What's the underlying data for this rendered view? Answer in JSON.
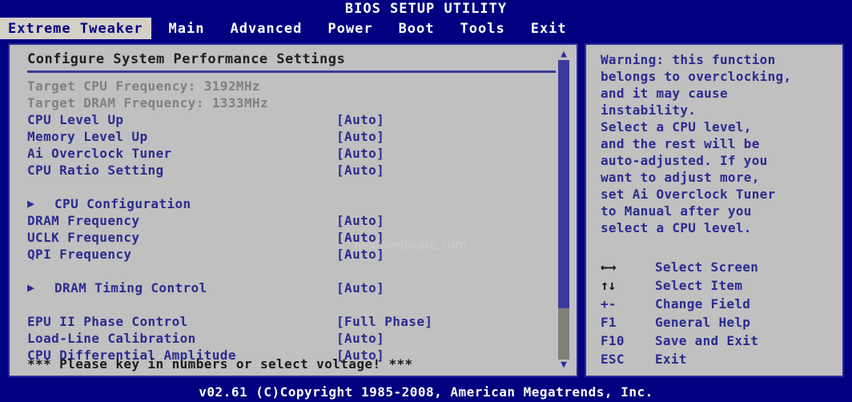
{
  "window": {
    "title": "BIOS SETUP UTILITY",
    "footer": "v02.61 (C)Copyright 1985-2008, American Megatrends, Inc."
  },
  "menubar": {
    "tabs": [
      {
        "label": "Extreme Tweaker",
        "active": true
      },
      {
        "label": "Main",
        "active": false
      },
      {
        "label": "Advanced",
        "active": false
      },
      {
        "label": "Power",
        "active": false
      },
      {
        "label": "Boot",
        "active": false
      },
      {
        "label": "Tools",
        "active": false
      },
      {
        "label": "Exit",
        "active": false
      }
    ]
  },
  "main": {
    "panel_title": "Configure System Performance Settings",
    "watermark": "nexthardware.com",
    "note": "*** Please key in numbers or select voltage! ***",
    "rows": [
      {
        "label": "Target CPU Frequency: 3192MHz",
        "value": "",
        "style": "dim"
      },
      {
        "label": "Target DRAM Frequency: 1333MHz",
        "value": "",
        "style": "dim"
      },
      {
        "label": "CPU Level Up",
        "value": "[Auto]",
        "style": "normal"
      },
      {
        "label": "Memory Level Up",
        "value": "[Auto]",
        "style": "normal"
      },
      {
        "label": "Ai Overclock Tuner",
        "value": "[Auto]",
        "style": "normal"
      },
      {
        "label": "CPU Ratio Setting",
        "value": "[Auto]",
        "style": "normal"
      },
      {
        "label": "",
        "value": "",
        "style": "gap"
      },
      {
        "label": "CPU Configuration",
        "value": "",
        "style": "submenu"
      },
      {
        "label": "DRAM Frequency",
        "value": "[Auto]",
        "style": "normal"
      },
      {
        "label": "UCLK Frequency",
        "value": "[Auto]",
        "style": "normal"
      },
      {
        "label": "QPI Frequency",
        "value": "[Auto]",
        "style": "normal"
      },
      {
        "label": "",
        "value": "",
        "style": "gap"
      },
      {
        "label": "DRAM Timing Control",
        "value": "[Auto]",
        "style": "submenu"
      },
      {
        "label": "",
        "value": "",
        "style": "gap"
      },
      {
        "label": "EPU II Phase Control",
        "value": "[Full Phase]",
        "style": "normal"
      },
      {
        "label": "Load-Line Calibration",
        "value": "[Auto]",
        "style": "normal"
      },
      {
        "label": "CPU Differential Amplitude",
        "value": "[Auto]",
        "style": "normal"
      }
    ],
    "scrollbar": {
      "up_arrow": "▲",
      "down_arrow": "▼",
      "thumb_percent": 83
    }
  },
  "help": {
    "text": "Warning: this function\nbelongs to overclocking,\nand it may cause\ninstability.\nSelect a CPU level,\nand the rest will be\nauto-adjusted. If you\nwant to adjust more,\nset Ai Overclock Tuner\nto Manual after you\nselect a CPU level.",
    "legend": [
      {
        "key": "←→",
        "desc": "Select Screen",
        "glyph": true
      },
      {
        "key": "↑↓",
        "desc": "Select Item",
        "glyph": true
      },
      {
        "key": "+-",
        "desc": "Change Field",
        "glyph": false
      },
      {
        "key": "F1",
        "desc": "General Help",
        "glyph": false
      },
      {
        "key": "F10",
        "desc": "Save and Exit",
        "glyph": false
      },
      {
        "key": "ESC",
        "desc": "Exit",
        "glyph": false
      }
    ]
  },
  "colors": {
    "navy": "#000080",
    "panel_bg": "#c0c0c0",
    "text_blue": "#2b2b8f",
    "dim_gray": "#808080",
    "border": "#2a2a9e"
  }
}
